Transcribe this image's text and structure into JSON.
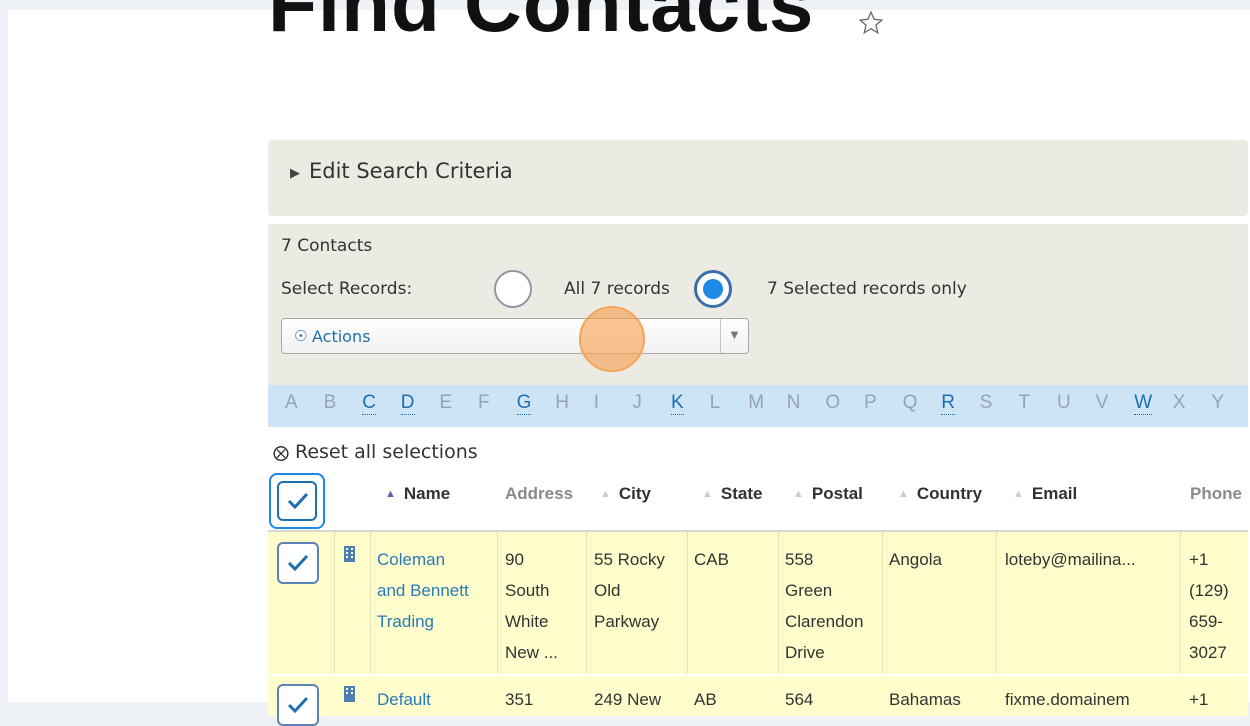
{
  "page": {
    "title": "Find Contacts",
    "search_criteria_label": "Edit Search Criteria",
    "contacts_count": "7 Contacts",
    "select_records_label": "Select Records:",
    "option_all": "All 7 records",
    "option_selected": "7 Selected records only",
    "selected_option": "7 Selected records only",
    "actions_label": "Actions",
    "reset_label": "Reset all selections"
  },
  "alphabet": [
    "A",
    "B",
    "C",
    "D",
    "E",
    "F",
    "G",
    "H",
    "I",
    "J",
    "K",
    "L",
    "M",
    "N",
    "O",
    "P",
    "Q",
    "R",
    "S",
    "T",
    "U",
    "V",
    "W",
    "X",
    "Y"
  ],
  "alphabet_active": [
    "C",
    "D",
    "G",
    "K",
    "R",
    "W"
  ],
  "table": {
    "columns": [
      "Name",
      "Address",
      "City",
      "State",
      "Postal",
      "Country",
      "Email",
      "Phone"
    ],
    "sorted_column": "Name",
    "rows": [
      {
        "name": "Coleman\nand Bennett\nTrading",
        "address": "90\nSouth\nWhite\nNew ...",
        "city": "55 Rocky\nOld\nParkway",
        "state": "CAB",
        "postal": "558\nGreen\nClarendon\nDrive",
        "country": "Angola",
        "email": "loteby@mailina...",
        "phone": "+1\n(129)\n659-\n3027"
      },
      {
        "name": "Default",
        "address": "351",
        "city": "249 New",
        "state": "AB",
        "postal": "564",
        "country": "Bahamas",
        "email": "fixme.domainem",
        "phone": "+1"
      }
    ]
  },
  "colors": {
    "criteria_bg": "#ebebe4",
    "alphabet_bg": "#cde4f7",
    "selected_row_bg": "#fffdcc",
    "link": "#2a7ab8",
    "radio_selected": "#1e88e5",
    "cursor_highlight": "#f7a050"
  }
}
